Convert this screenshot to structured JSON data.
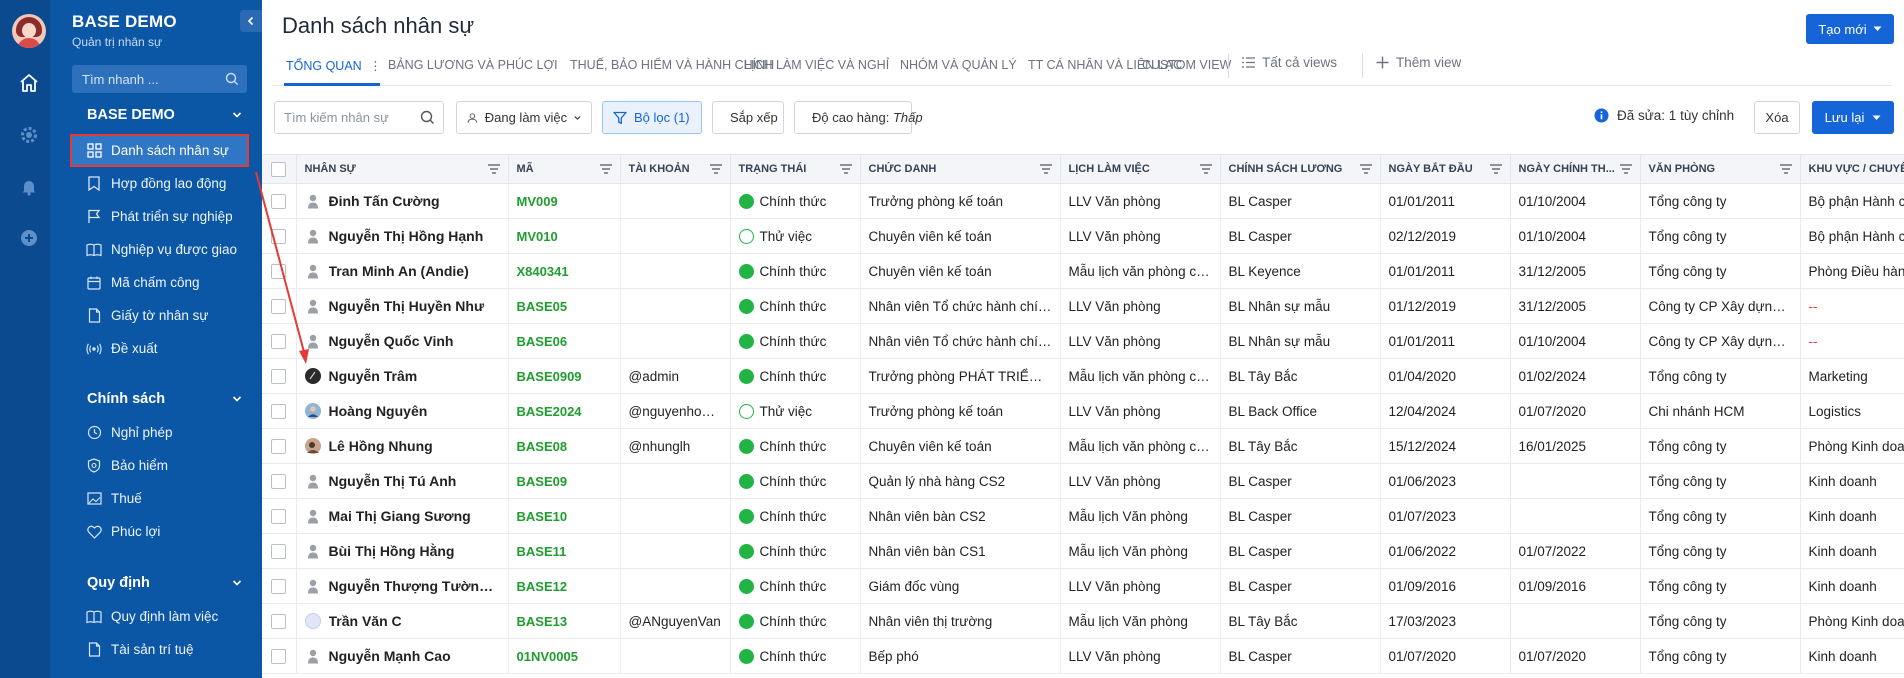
{
  "app": {
    "title": "BASE DEMO",
    "subtitle": "Quản trị nhân sự",
    "search_placeholder": "Tìm nhanh ..."
  },
  "sidebar": {
    "sections": [
      {
        "label": "BASE DEMO",
        "items": [
          {
            "label": "Danh sách nhân sự",
            "icon": "grid-icon",
            "active": true
          },
          {
            "label": "Hợp đồng lao động",
            "icon": "bookmark-icon"
          },
          {
            "label": "Phát triển sự nghiệp",
            "icon": "flag-icon"
          },
          {
            "label": "Nghiệp vụ được giao",
            "icon": "book-icon"
          },
          {
            "label": "Mã chấm công",
            "icon": "calendar-icon"
          },
          {
            "label": "Giấy tờ nhân sự",
            "icon": "document-icon"
          },
          {
            "label": "Đề xuất",
            "icon": "broadcast-icon"
          }
        ]
      },
      {
        "label": "Chính sách",
        "items": [
          {
            "label": "Nghỉ phép",
            "icon": "clock-icon"
          },
          {
            "label": "Bảo hiểm",
            "icon": "shield-icon"
          },
          {
            "label": "Thuế",
            "icon": "image-icon"
          },
          {
            "label": "Phúc lợi",
            "icon": "heart-icon"
          }
        ]
      },
      {
        "label": "Quy định",
        "items": [
          {
            "label": "Quy định làm việc",
            "icon": "book-icon"
          },
          {
            "label": "Tài sản trí tuệ",
            "icon": "document-icon"
          }
        ]
      }
    ]
  },
  "header": {
    "title": "Danh sách nhân sự",
    "create_label": "Tạo mới"
  },
  "tabs": [
    {
      "label": "TỔNG QUAN",
      "active": true
    },
    {
      "label": "BẢNG LƯƠNG VÀ PHÚC LỢI"
    },
    {
      "label": "THUẾ, BẢO HIỂM VÀ HÀNH CHÍNH"
    },
    {
      "label": "LỊCH LÀM VIỆC VÀ NGHỈ"
    },
    {
      "label": "NHÓM VÀ QUẢN LÝ"
    },
    {
      "label": "TT CÁ NHÂN VÀ LIÊN LẠC"
    },
    {
      "label": "CUSTOM VIEW"
    }
  ],
  "view_actions": {
    "all_views": "Tất cả views",
    "add_view": "Thêm view"
  },
  "toolbar": {
    "search_placeholder": "Tìm kiếm nhân sự",
    "status_filter": "Đang làm việc",
    "filter_label": "Bộ lọc (1)",
    "sort_label": "Sắp xếp",
    "row_height_label": "Độ cao hàng:",
    "row_height_value": "Thấp",
    "edited_text": "Đã sửa: 1 tùy chỉnh",
    "clear_label": "Xóa",
    "save_label": "Lưu lại"
  },
  "table": {
    "columns": [
      "NHÂN SỰ",
      "MÃ",
      "TÀI KHOẢN",
      "TRẠNG THÁI",
      "CHỨC DANH",
      "LỊCH LÀM VIỆC",
      "CHÍNH SÁCH LƯƠNG",
      "NGÀY BẮT ĐẦU",
      "NGÀY CHÍNH TH...",
      "VĂN PHÒNG",
      "KHU VỰC / CHUYÊN"
    ],
    "rows": [
      {
        "name": "Đinh Tấn Cường",
        "code": "MV009",
        "account": "",
        "status": "Chính thức",
        "status_type": "full",
        "title": "Trưởng phòng kế toán",
        "schedule": "LLV Văn phòng",
        "salary": "BL Casper",
        "start": "01/01/2011",
        "official": "01/10/2004",
        "office": "Tổng công ty",
        "area": "Bộ phận Hành c",
        "avatar": "default"
      },
      {
        "name": "Nguyễn Thị Hồng Hạnh",
        "code": "MV010",
        "account": "",
        "status": "Thử việc",
        "status_type": "trial",
        "title": "Chuyên viên kế toán",
        "schedule": "LLV Văn phòng",
        "salary": "BL Casper",
        "start": "02/12/2019",
        "official": "01/10/2004",
        "office": "Tổng công ty",
        "area": "Bộ phận Hành c",
        "avatar": "default"
      },
      {
        "name": "Tran Minh An (Andie)",
        "code": "X840341",
        "account": "",
        "status": "Chính thức",
        "status_type": "full",
        "title": "Chuyên viên kế toán",
        "schedule": "Mẫu lịch văn phòng cố...",
        "salary": "BL Keyence",
        "start": "01/01/2011",
        "official": "31/12/2005",
        "office": "Tổng công ty",
        "area": "Phòng Điều hàn",
        "avatar": "default"
      },
      {
        "name": "Nguyễn Thị Huyền Như",
        "code": "BASE05",
        "account": "",
        "status": "Chính thức",
        "status_type": "full",
        "title": "Nhân viên Tổ chức hành chính",
        "schedule": "LLV Văn phòng",
        "salary": "BL Nhân sự mẫu",
        "start": "01/12/2019",
        "official": "31/12/2005",
        "office": "Công ty CP Xây dựng v...",
        "area": "--",
        "avatar": "default"
      },
      {
        "name": "Nguyễn Quốc Vinh",
        "code": "BASE06",
        "account": "",
        "status": "Chính thức",
        "status_type": "full",
        "title": "Nhân viên Tổ chức hành chính",
        "schedule": "LLV Văn phòng",
        "salary": "BL Nhân sự mẫu",
        "start": "01/01/2011",
        "official": "01/10/2004",
        "office": "Công ty CP Xây dựng v...",
        "area": "--",
        "avatar": "default"
      },
      {
        "name": "Nguyễn Trâm",
        "code": "BASE0909",
        "account": "@admin",
        "status": "Chính thức",
        "status_type": "full",
        "title": "Trưởng phòng PHÁT TRIỂN Đ...",
        "schedule": "Mẫu lịch văn phòng cố...",
        "salary": "BL Tây Bắc",
        "start": "01/04/2020",
        "official": "01/02/2024",
        "office": "Tổng công ty",
        "area": "Marketing",
        "avatar": "dark"
      },
      {
        "name": "Hoàng Nguyên",
        "code": "BASE2024",
        "account": "@nguyenhoang",
        "status": "Thử việc",
        "status_type": "trial",
        "title": "Trưởng phòng kế toán",
        "schedule": "LLV Văn phòng",
        "salary": "BL Back Office",
        "start": "12/04/2024",
        "official": "01/07/2020",
        "office": "Chi nhánh HCM",
        "area": "Logistics",
        "avatar": "photo"
      },
      {
        "name": "Lê Hồng Nhung",
        "code": "BASE08",
        "account": "@nhunglh",
        "status": "Chính thức",
        "status_type": "full",
        "title": "Chuyên viên kế toán",
        "schedule": "Mẫu lịch văn phòng cố...",
        "salary": "BL Tây Bắc",
        "start": "15/12/2024",
        "official": "16/01/2025",
        "office": "Tổng công ty",
        "area": "Phòng Kinh doa",
        "avatar": "photo2"
      },
      {
        "name": "Nguyễn Thị Tú Anh",
        "code": "BASE09",
        "account": "",
        "status": "Chính thức",
        "status_type": "full",
        "title": "Quản lý nhà hàng CS2",
        "schedule": "LLV Văn phòng",
        "salary": "BL Casper",
        "start": "01/06/2023",
        "official": "",
        "office": "Tổng công ty",
        "area": "Kinh doanh",
        "avatar": "default"
      },
      {
        "name": "Mai Thị Giang Sương",
        "code": "BASE10",
        "account": "",
        "status": "Chính thức",
        "status_type": "full",
        "title": "Nhân viên bàn CS2",
        "schedule": "Mẫu lịch Văn phòng",
        "salary": "BL Casper",
        "start": "01/07/2023",
        "official": "",
        "office": "Tổng công ty",
        "area": "Kinh doanh",
        "avatar": "default"
      },
      {
        "name": "Bùi Thị Hồng Hằng",
        "code": "BASE11",
        "account": "",
        "status": "Chính thức",
        "status_type": "full",
        "title": "Nhân viên bàn CS1",
        "schedule": "Mẫu lịch Văn phòng",
        "salary": "BL Casper",
        "start": "01/06/2022",
        "official": "01/07/2022",
        "office": "Tổng công ty",
        "area": "Kinh doanh",
        "avatar": "default"
      },
      {
        "name": "Nguyễn Thượng Tường ...",
        "code": "BASE12",
        "account": "",
        "status": "Chính thức",
        "status_type": "full",
        "title": "Giám đốc vùng",
        "schedule": "LLV Văn phòng",
        "salary": "BL Casper",
        "start": "01/09/2016",
        "official": "01/09/2016",
        "office": "Tổng công ty",
        "area": "Kinh doanh",
        "avatar": "default"
      },
      {
        "name": "Trần Văn C",
        "code": "BASE13",
        "account": "@ANguyenVan",
        "status": "Chính thức",
        "status_type": "full",
        "title": "Nhân viên thị trường",
        "schedule": "Mẫu lịch Văn phòng",
        "salary": "BL Tây Bắc",
        "start": "17/03/2023",
        "official": "",
        "office": "Tổng công ty",
        "area": "Phòng Kinh doa",
        "avatar": "light"
      },
      {
        "name": "Nguyễn Mạnh Cao",
        "code": "01NV0005",
        "account": "",
        "status": "Chính thức",
        "status_type": "full",
        "title": "Bếp phó",
        "schedule": "LLV Văn phòng",
        "salary": "BL Casper",
        "start": "01/07/2020",
        "official": "01/07/2020",
        "office": "Tổng công ty",
        "area": "Kinh doanh",
        "avatar": "default"
      }
    ]
  },
  "colors": {
    "rail": "#0b4a8f",
    "sidebar": "#0c56a6",
    "accent": "#1565d8",
    "code_green": "#1f9d2f",
    "status_green": "#22b345",
    "highlight_red": "#e53935"
  }
}
